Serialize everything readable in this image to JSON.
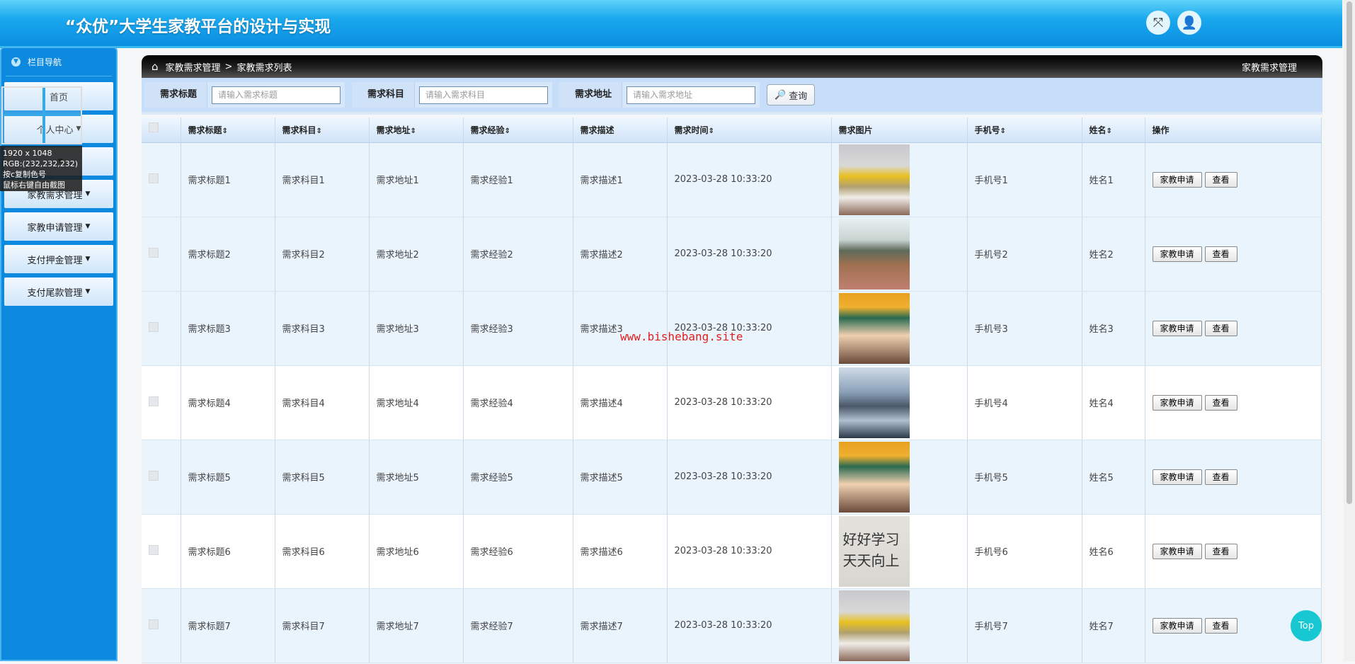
{
  "header": {
    "title": "“众优”大学生家教平台的设计与实现",
    "icons": [
      "fullscreen-icon",
      "user-icon"
    ]
  },
  "sidebar": {
    "title": "栏目导航",
    "items": [
      {
        "label": "首页",
        "caret": false
      },
      {
        "label": "个人中心",
        "caret": true
      },
      {
        "label": "",
        "caret": true
      },
      {
        "label": "家教需求管理",
        "caret": true
      },
      {
        "label": "家教申请管理",
        "caret": true
      },
      {
        "label": "支付押金管理",
        "caret": true
      },
      {
        "label": "支付尾款管理",
        "caret": true
      }
    ]
  },
  "overlay": {
    "line1": "1920 x 1048",
    "line2": "RGB:(232,232,232)",
    "line3": "按c复制色号",
    "line4": "鼠标右键自由截图"
  },
  "breadcrumb": {
    "level1": "家教需求管理",
    "sep": ">",
    "level2": "家教需求列表",
    "right": "家教需求管理"
  },
  "search": {
    "fields": [
      {
        "label": "需求标题",
        "placeholder": "请输入需求标题"
      },
      {
        "label": "需求科目",
        "placeholder": "请输入需求科目"
      },
      {
        "label": "需求地址",
        "placeholder": "请输入需求地址"
      }
    ],
    "button": "查询"
  },
  "table": {
    "headers": [
      "需求标题",
      "需求科目",
      "需求地址",
      "需求经验",
      "需求描述",
      "需求时间",
      "需求图片",
      "手机号",
      "姓名",
      "操作"
    ],
    "sortable": [
      true,
      true,
      true,
      true,
      false,
      true,
      false,
      true,
      true,
      false
    ],
    "rows": [
      {
        "title": "需求标题1",
        "subject": "需求科目1",
        "address": "需求地址1",
        "experience": "需求经验1",
        "desc": "需求描述1",
        "time": "2023-03-28 10:33:20",
        "image": "classroom-yellow",
        "phone": "手机号1",
        "name": "姓名1"
      },
      {
        "title": "需求标题2",
        "subject": "需求科目2",
        "address": "需求地址2",
        "experience": "需求经验2",
        "desc": "需求描述2",
        "time": "2023-03-28 10:33:20",
        "image": "classroom-wide",
        "phone": "手机号2",
        "name": "姓名2"
      },
      {
        "title": "需求标题3",
        "subject": "需求科目3",
        "address": "需求地址3",
        "experience": "需求经验3",
        "desc": "需求描述3",
        "time": "2023-03-28 10:33:20",
        "image": "raised-hands",
        "phone": "手机号3",
        "name": "姓名3"
      },
      {
        "title": "需求标题4",
        "subject": "需求科目4",
        "address": "需求地址4",
        "experience": "需求经验4",
        "desc": "需求描述4",
        "time": "2023-03-28 10:33:20",
        "image": "computer-class",
        "phone": "手机号4",
        "name": "姓名4"
      },
      {
        "title": "需求标题5",
        "subject": "需求科目5",
        "address": "需求地址5",
        "experience": "需求经验5",
        "desc": "需求描述5",
        "time": "2023-03-28 10:33:20",
        "image": "raised-hands",
        "phone": "手机号5",
        "name": "姓名5"
      },
      {
        "title": "需求标题6",
        "subject": "需求科目6",
        "address": "需求地址6",
        "experience": "需求经验6",
        "desc": "需求描述6",
        "time": "2023-03-28 10:33:20",
        "image": "handwriting",
        "phone": "手机号6",
        "name": "姓名6"
      },
      {
        "title": "需求标题7",
        "subject": "需求科目7",
        "address": "需求地址7",
        "experience": "需求经验7",
        "desc": "需求描述7",
        "time": "2023-03-28 10:33:20",
        "image": "classroom-yellow",
        "phone": "手机号7",
        "name": "姓名7"
      }
    ],
    "actions": {
      "apply": "家教申请",
      "view": "查看"
    }
  },
  "watermark": "www.bishebang.site",
  "top_button": "Top"
}
